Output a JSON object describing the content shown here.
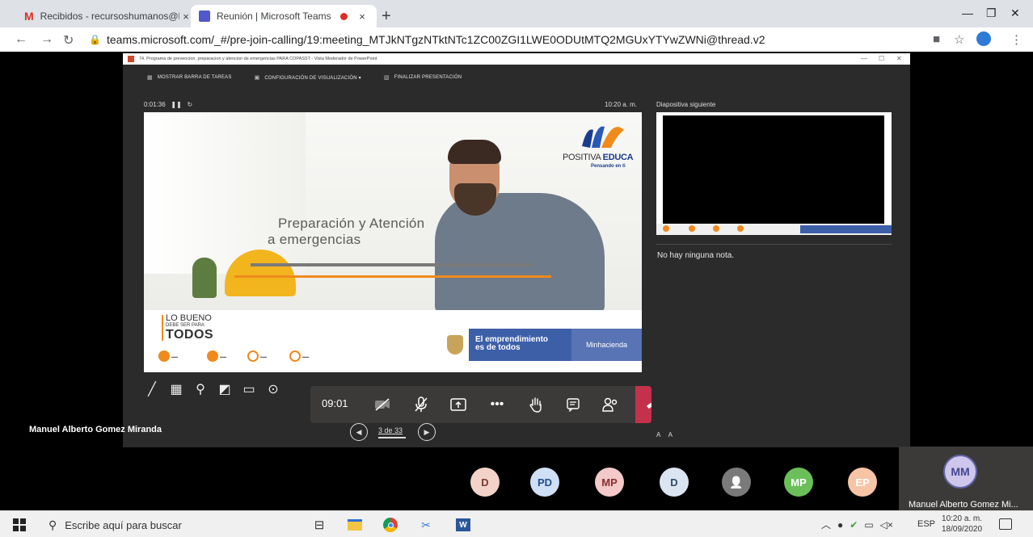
{
  "browser": {
    "tabs": [
      {
        "title": "Recibidos - recursoshumanos@h",
        "icon": "gmail-icon",
        "active": false
      },
      {
        "title": "Reunión | Microsoft Teams",
        "icon": "teams-icon",
        "active": true
      }
    ],
    "close_glyph": "×",
    "new_tab_glyph": "+",
    "url": "teams.microsoft.com/_#/pre-join-calling/19:meeting_MTJkNTgzNTktNTc1ZC00ZGI1LWE0ODUtMTQ2MGUxYTYwZWNi@thread.v2"
  },
  "ppt": {
    "window_title": "74. Programa de prevencion, preparacion y atencion de emergencias PARA COPASST - Vista Moderador de PowerPoint",
    "toolbar": {
      "show_taskbar": "MOSTRAR BARRA DE TAREAS",
      "display_settings": "CONFIGURACIÓN DE VISUALIZACIÓN ▾",
      "end_show": "FINALIZAR PRESENTACIÓN"
    },
    "timer": "0:01:36",
    "clock": "10:20 a. m.",
    "next_slide_label": "Diapositiva siguiente",
    "notes": "No hay ninguna nota.",
    "page": "3 de 33",
    "slide": {
      "title_line1": "Preparación y Atención",
      "title_line2": "a emergencias",
      "brand_part1": "POSITIVA ",
      "brand_part2": "EDUCA",
      "brand_tagline": "Pensando en ti",
      "slogan_1": "LO BUENO",
      "slogan_2": "DEBE SER PARA",
      "slogan_3": "TODOS",
      "gov_line1": "El emprendimiento",
      "gov_line2": "es de todos",
      "ministry": "Minhacienda"
    }
  },
  "call": {
    "duration": "09:01",
    "presenter": "Manuel Alberto Gomez Miranda"
  },
  "participants": [
    {
      "initials": "D",
      "bg": "#f3d3c9",
      "fg": "#7a3b2b"
    },
    {
      "initials": "PD",
      "bg": "#cfdff5",
      "fg": "#1f4e8c"
    },
    {
      "initials": "MP",
      "bg": "#f3c9c9",
      "fg": "#8a2f2f"
    },
    {
      "initials": "D",
      "bg": "#dbe5f1",
      "fg": "#2d4a6b"
    },
    {
      "initials": "",
      "bg": "#7a7a7a",
      "fg": "#ffffff"
    },
    {
      "initials": "MP",
      "bg": "#6bbf59",
      "fg": "#ffffff"
    },
    {
      "initials": "EP",
      "bg": "#f7c4a6",
      "fg": "#ffffff"
    }
  ],
  "self": {
    "initials": "MM",
    "name": "Manuel Alberto Gomez Mi..."
  },
  "taskbar": {
    "search_placeholder": "Escribe aquí para buscar",
    "lang": "ESP",
    "time": "10:20 a. m.",
    "date": "18/09/2020"
  },
  "colors": {
    "hangup": "#c4314b",
    "teams_accent": "#6264a7",
    "brand_orange": "#f08a1c",
    "gov_blue": "#3d5fa8"
  }
}
